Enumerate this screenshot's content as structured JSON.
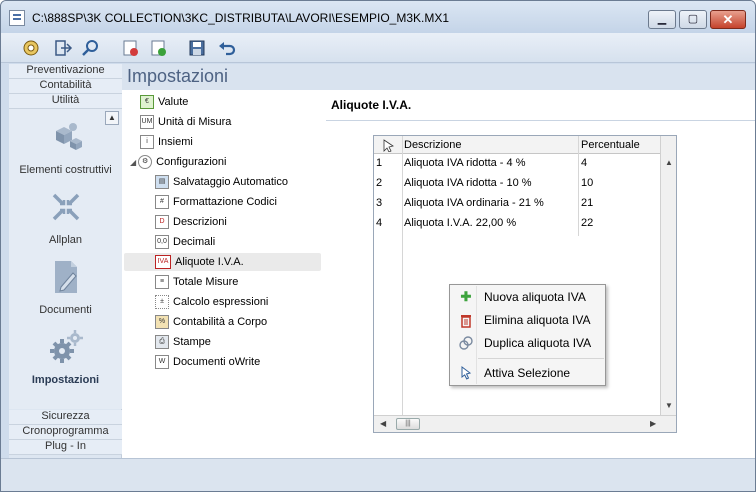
{
  "window": {
    "title": "C:\\888SP\\3K COLLECTION\\3KC_DISTRIBUTA\\LAVORI\\ESEMPIO_M3K.MX1"
  },
  "sidebar": {
    "top_links": [
      "Preventivazione",
      "Contabilità",
      "Utilità"
    ],
    "items": [
      {
        "label": "Elementi costruttivi",
        "icon": "building-blocks-icon"
      },
      {
        "label": "Allplan",
        "icon": "allplan-icon"
      },
      {
        "label": "Documenti",
        "icon": "document-edit-icon"
      },
      {
        "label": "Impostazioni",
        "icon": "gears-icon",
        "active": true
      }
    ],
    "bottom_links": [
      "Sicurezza",
      "Cronoprogramma",
      "Plug - In"
    ]
  },
  "page": {
    "title": "Impostazioni"
  },
  "tree": {
    "nodes": [
      {
        "label": "Valute",
        "level": 0,
        "icon": "currency-icon"
      },
      {
        "label": "Unità di Misura",
        "level": 0,
        "icon": "unit-icon"
      },
      {
        "label": "Insiemi",
        "level": 0,
        "icon": "info-icon"
      },
      {
        "label": "Configurazioni",
        "level": 0,
        "icon": "gear-icon",
        "expanded": true
      },
      {
        "label": "Salvataggio Automatico",
        "level": 1,
        "icon": "save-icon"
      },
      {
        "label": "Formattazione Codici",
        "level": 1,
        "icon": "hash-icon"
      },
      {
        "label": "Descrizioni",
        "level": 1,
        "icon": "description-icon"
      },
      {
        "label": "Decimali",
        "level": 1,
        "icon": "decimal-icon"
      },
      {
        "label": "Aliquote I.V.A.",
        "level": 1,
        "icon": "iva-icon",
        "selected": true
      },
      {
        "label": "Totale Misure",
        "level": 1,
        "icon": "list-icon"
      },
      {
        "label": "Calcolo espressioni",
        "level": 1,
        "icon": "calculator-icon"
      },
      {
        "label": "Contabilità a Corpo",
        "level": 1,
        "icon": "percent-icon"
      },
      {
        "label": "Stampe",
        "level": 1,
        "icon": "printer-icon"
      },
      {
        "label": "Documenti oWrite",
        "level": 1,
        "icon": "word-doc-icon"
      }
    ]
  },
  "panel": {
    "heading": "Aliquote I.V.A.",
    "grid": {
      "columns": [
        "Descrizione",
        "Percentuale"
      ],
      "rows": [
        {
          "n": "1",
          "descr": "Aliquota IVA ridotta - 4 %",
          "perc": "4"
        },
        {
          "n": "2",
          "descr": "Aliquota IVA ridotta - 10 %",
          "perc": "10"
        },
        {
          "n": "3",
          "descr": "Aliquota IVA ordinaria - 21 %",
          "perc": "21"
        },
        {
          "n": "4",
          "descr": "Aliquota I.V.A. 22,00 %",
          "perc": "22"
        }
      ]
    }
  },
  "context_menu": {
    "items": [
      {
        "label": "Nuova aliquota IVA",
        "icon": "plus-icon"
      },
      {
        "label": "Elimina aliquota IVA",
        "icon": "trash-icon"
      },
      {
        "label": "Duplica aliquota IVA",
        "icon": "duplicate-icon"
      },
      {
        "label": "Attiva Selezione",
        "icon": "cursor-icon"
      }
    ]
  },
  "colors": {
    "title_accent": "#4d6283",
    "add": "#3da33d",
    "delete": "#c0392b"
  }
}
